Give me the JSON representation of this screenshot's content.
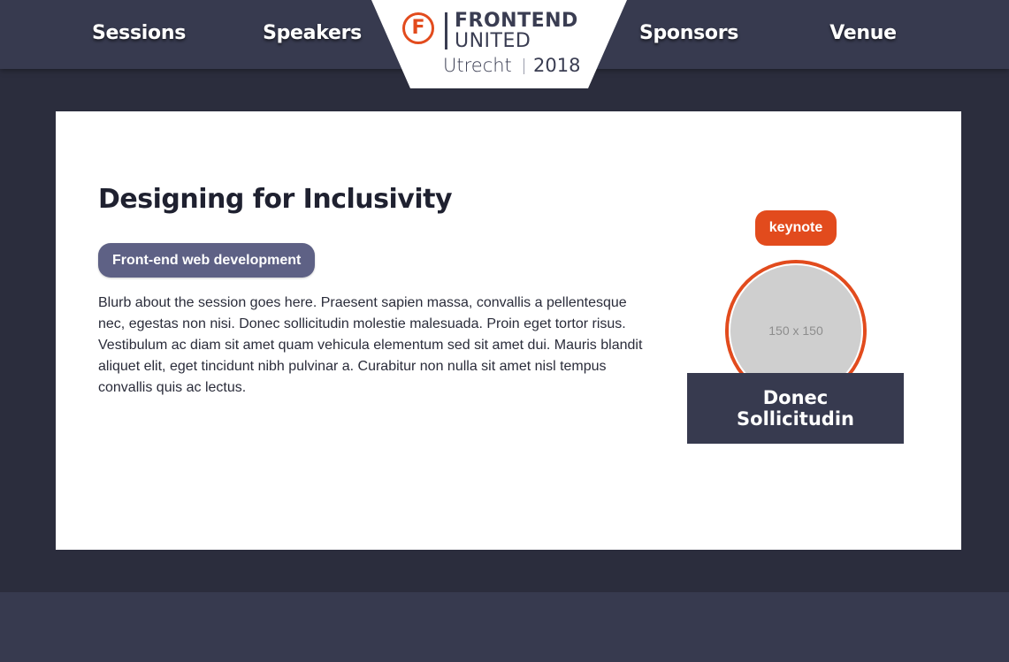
{
  "nav": {
    "items": [
      "Sessions",
      "Speakers",
      "Sponsors",
      "Venue"
    ]
  },
  "logo": {
    "mark": "F",
    "line1": "FRONTEND",
    "line2": "UNITED",
    "city": "Utrecht",
    "year": "2018"
  },
  "session": {
    "title": "Designing for Inclusivity",
    "track": "Front-end web development",
    "blurb": "Blurb about the session goes here. Praesent sapien massa, convallis a pellentesque nec, egestas non nisi. Donec sollicitudin molestie malesuada. Proin eget tortor risus. Vestibulum ac diam sit amet quam vehicula elementum sed sit amet dui. Mauris blandit aliquet elit, eget tincidunt nibh pulvinar a. Curabitur non nulla sit amet nisl tempus convallis quis ac lectus."
  },
  "speaker": {
    "badge": "keynote",
    "avatar_placeholder": "150 x 150",
    "name_line1": "Donec",
    "name_line2": "Sollicitudin"
  },
  "colors": {
    "accent": "#e24b1d",
    "nav_bg": "#373a4f",
    "page_bg": "#2b2d3d",
    "pill": "#5e6185"
  }
}
